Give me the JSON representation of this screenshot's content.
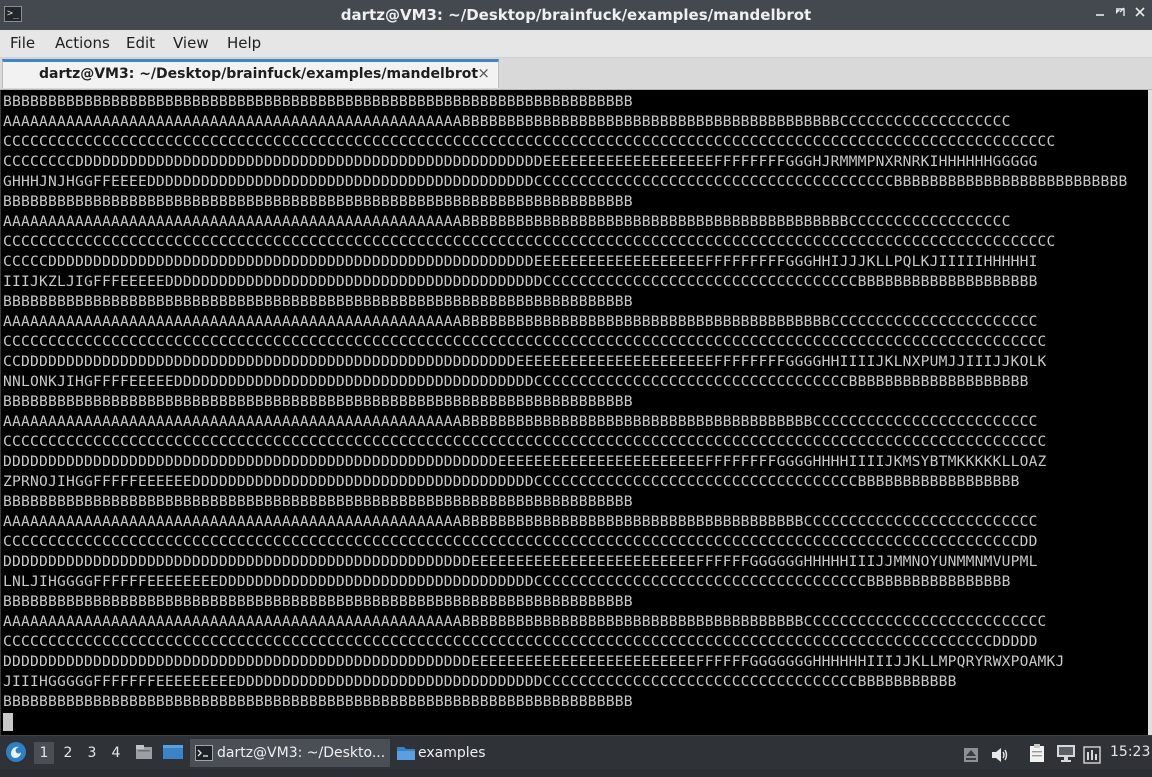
{
  "window": {
    "title": "dartz@VM3: ~/Desktop/brainfuck/examples/mandelbrot",
    "icons": [
      "terminal-icon",
      "minimize-icon",
      "maximize-icon",
      "close-icon"
    ]
  },
  "menu": {
    "items": [
      "File",
      "Actions",
      "Edit",
      "View",
      "Help"
    ]
  },
  "tab": {
    "label": "dartz@VM3: ~/Desktop/brainfuck/examples/mandelbrot",
    "close": "×"
  },
  "terminal": {
    "lines": [
      "BBBBBBBBBBBBBBBBBBBBBBBBBBBBBBBBBBBBBBBBBBBBBBBBBBBBBBBBBBBBBBBBBBBBBB",
      "AAAAAAAAAAAAAAAAAAAAAAAAAAAAAAAAAAAAAAAAAAAAAAAAAAABBBBBBBBBBBBBBBBBBBBBBBBBBBBBBBBBBBBBBBBBBCCCCCCCCCCCCCCCCCCC",
      "CCCCCCCCCCCCCCCCCCCCCCCCCCCCCCCCCCCCCCCCCCCCCCCCCCCCCCCCCCCCCCCCCCCCCCCCCCCCCCCCCCCCCCCCCCCCCCCCCCCCCCCCCCCCCCCCCCCCC",
      "CCCCCCCCDDDDDDDDDDDDDDDDDDDDDDDDDDDDDDDDDDDDDDDDDDDDDDDDDDDDEEEEEEEEEEEEEEEEEEEFFFFFFFFGGGHJRMMMPNXRNRKIHHHHHHGGGGG",
      "GHHHJNJHGGFFEEEEDDDDDDDDDDDDDDDDDDDDDDDDDDDDDDDDDDDDDDDDDDDCCCCCCCCCCCCCCCCCCCCCCCCCCCCCCCCCCCCCCCCBBBBBBBBBBBBBBBBBBBBBBBBBB",
      "BBBBBBBBBBBBBBBBBBBBBBBBBBBBBBBBBBBBBBBBBBBBBBBBBBBBBBBBBBBBBBBBBBBBBB",
      "AAAAAAAAAAAAAAAAAAAAAAAAAAAAAAAAAAAAAAAAAAAAAAAAAAABBBBBBBBBBBBBBBBBBBBBBBBBBBBBBBBBBBBBBBBBBBCCCCCCCCCCCCCCCCCC",
      "CCCCCCCCCCCCCCCCCCCCCCCCCCCCCCCCCCCCCCCCCCCCCCCCCCCCCCCCCCCCCCCCCCCCCCCCCCCCCCCCCCCCCCCCCCCCCCCCCCCCCCCCCCCCCCCCCCCCC",
      "CCCCCDDDDDDDDDDDDDDDDDDDDDDDDDDDDDDDDDDDDDDDDDDDDDDDDDDDDDDEEEEEEEEEEEEEEEEEEEFFFFFFFFFGGGHHIJJJKLLPQLKJIIIIIHHHHHI",
      "IIIJKZLJIGFFFEEEEEDDDDDDDDDDDDDDDDDDDDDDDDDDDDDDDDDDDDDDDDDDCCCCCCCCCCCCCCCCCCCCCCCCCCCCCCCCCCCBBBBBBBBBBBBBBBBBBBB",
      "BBBBBBBBBBBBBBBBBBBBBBBBBBBBBBBBBBBBBBBBBBBBBBBBBBBBBBBBBBBBBBBBBBBBBB",
      "AAAAAAAAAAAAAAAAAAAAAAAAAAAAAAAAAAAAAAAAAAAAAAAAAAABBBBBBBBBBBBBBBBBBBBBBBBBBBBBBBBBBBBBBBBBCCCCCCCCCCCCCCCCCCCCCCC",
      "CCCCCCCCCCCCCCCCCCCCCCCCCCCCCCCCCCCCCCCCCCCCCCCCCCCCCCCCCCCCCCCCCCCCCCCCCCCCCCCCCCCCCCCCCCCCCCCCCCCCCCCCCCCCCCCCCCCC",
      "CCDDDDDDDDDDDDDDDDDDDDDDDDDDDDDDDDDDDDDDDDDDDDDDDDDDDDDDDEEEEEEEEEEEEEEEEEEEEEEFFFFFFFFGGGGHHIIIIJKLNXPUMJJIIIJJKOLK",
      "NNLONKJIHGFFFFEEEEEDDDDDDDDDDDDDDDDDDDDDDDDDDDDDDDDDDDDDDDDCCCCCCCCCCCCCCCCCCCCCCCCCCCCCCCCCCCBBBBBBBBBBBBBBBBBBBB",
      "BBBBBBBBBBBBBBBBBBBBBBBBBBBBBBBBBBBBBBBBBBBBBBBBBBBBBBBBBBBBBBBBBBBBBB",
      "AAAAAAAAAAAAAAAAAAAAAAAAAAAAAAAAAAAAAAAAAAAAAAAAAAABBBBBBBBBBBBBBBBBBBBBBBBBBBBBBBBBBBBBBBCCCCCCCCCCCCCCCCCCCCCCCCC",
      "CCCCCCCCCCCCCCCCCCCCCCCCCCCCCCCCCCCCCCCCCCCCCCCCCCCCCCCCCCCCCCCCCCCCCCCCCCCCCCCCCCCCCCCCCCCCCCCCCCCCCCCCCCCCCCCCCCCC",
      "DDDDDDDDDDDDDDDDDDDDDDDDDDDDDDDDDDDDDDDDDDDDDDDDDDDDDDDEEEEEEEEEEEEEEEEEEEEEEEFFFFFFFFGGGGHHHHIIIIJKMSYBTMKKKKKLLOAZ",
      "ZPRNOJIHGGFFFFFEEEEEEDDDDDDDDDDDDDDDDDDDDDDDDDDDDDDDDDDDDDDCCCCCCCCCCCCCCCCCCCCCCCCCCCCCCCCCCCCBBBBBBBBBBBBBBBBBB",
      "BBBBBBBBBBBBBBBBBBBBBBBBBBBBBBBBBBBBBBBBBBBBBBBBBBBBBBBBBBBBBBBBBBBBBB",
      "AAAAAAAAAAAAAAAAAAAAAAAAAAAAAAAAAAAAAAAAAAAAAAAAAAABBBBBBBBBBBBBBBBBBBBBBBBBBBBBBBBBBBBBBCCCCCCCCCCCCCCCCCCCCCCCCCC",
      "CCCCCCCCCCCCCCCCCCCCCCCCCCCCCCCCCCCCCCCCCCCCCCCCCCCCCCCCCCCCCCCCCCCCCCCCCCCCCCCCCCCCCCCCCCCCCCCCCCCCCCCCCCCCCCCCCDD",
      "DDDDDDDDDDDDDDDDDDDDDDDDDDDDDDDDDDDDDDDDDDDDDDDDDDDDEEEEEEEEEEEEEEEEEEEEEEEEEFFFFFFGGGGGGHHHHHIIIJJMMNOYUNMMNMVUPML",
      "LNLJIHGGGGFFFFFFEEEEEEEEDDDDDDDDDDDDDDDDDDDDDDDDDDDDDDDDDDDCCCCCCCCCCCCCCCCCCCCCCCCCCCCCCCCCCCCCBBBBBBBBBBBBBBBB",
      "BBBBBBBBBBBBBBBBBBBBBBBBBBBBBBBBBBBBBBBBBBBBBBBBBBBBBBBBBBBBBBBBBBBBBB",
      "AAAAAAAAAAAAAAAAAAAAAAAAAAAAAAAAAAAAAAAAAAAAAAAAAAABBBBBBBBBBBBBBBBBBBBBBBBBBBBBBBBBBBBBBCCCCCCCCCCCCCCCCCCCCCCCCCCC",
      "CCCCCCCCCCCCCCCCCCCCCCCCCCCCCCCCCCCCCCCCCCCCCCCCCCCCCCCCCCCCCCCCCCCCCCCCCCCCCCCCCCCCCCCCCCCCCCCCCCCCCCCCCCCCCCDDDDD",
      "DDDDDDDDDDDDDDDDDDDDDDDDDDDDDDDDDDDDDDDDDDDDDDDDDDDDEEEEEEEEEEEEEEEEEEEEEEEEEFFFFFFGGGGGGGHHHHHHIIIJJKLLMPQRYRWXPOAMKJ",
      "JIIIHGGGGGFFFFFFFEEEEEEEEEDDDDDDDDDDDDDDDDDDDDDDDDDDDDDDDDDDCCCCCCCCCCCCCCCCCCCCCCCCCCCCCCCCCCCBBBBBBBBBBB",
      "BBBBBBBBBBBBBBBBBBBBBBBBBBBBBBBBBBBBBBBBBBBBBBBBBBBBBBBBBBBBBBBBBBBBBB"
    ]
  },
  "taskbar": {
    "start_icon": "start-menu-icon",
    "desktops": [
      "1",
      "2",
      "3",
      "4"
    ],
    "active_desktop": "1",
    "tasks": [
      {
        "label": "dartz@VM3: ~/Deskto...",
        "icon": "terminal-icon"
      },
      {
        "label": "examples",
        "icon": "folder-icon"
      }
    ],
    "tray_icons": [
      "eject-icon",
      "volume-icon",
      "clipboard-icon",
      "network-icon",
      "notification-icon"
    ],
    "clock": "15:23"
  }
}
